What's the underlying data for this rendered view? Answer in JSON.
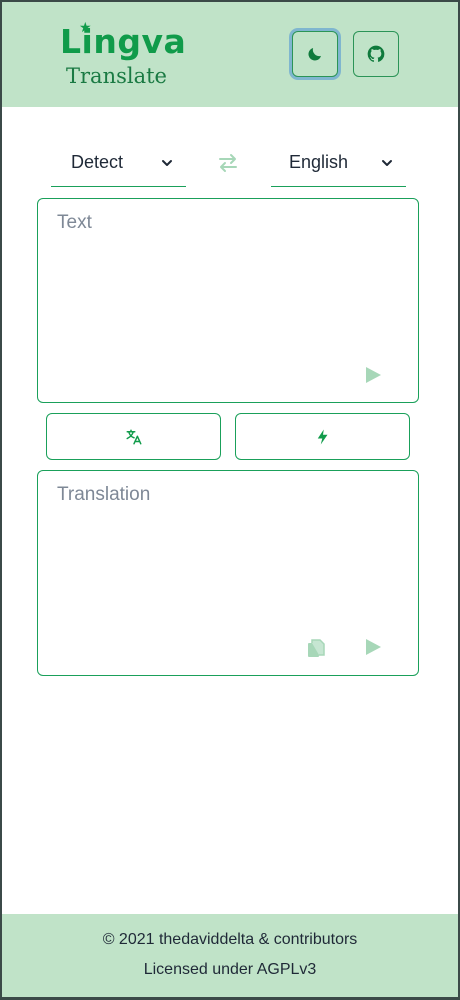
{
  "header": {
    "logo_title": "Lingva",
    "logo_subtitle": "Translate",
    "theme_button": "dark-mode-toggle",
    "github_button": "github-link"
  },
  "languages": {
    "source": "Detect",
    "target": "English"
  },
  "input": {
    "placeholder": "Text"
  },
  "output": {
    "placeholder": "Translation"
  },
  "actions": {
    "translate_icon": "translate-icon",
    "auto_icon": "lightning-icon"
  },
  "footer": {
    "copyright": "© 2021 thedaviddelta & contributors",
    "license": "Licensed under AGPLv3"
  },
  "colors": {
    "accent": "#1aa05a",
    "header_bg": "#c0e3c8",
    "disabled_icon": "#a7d7b8"
  }
}
